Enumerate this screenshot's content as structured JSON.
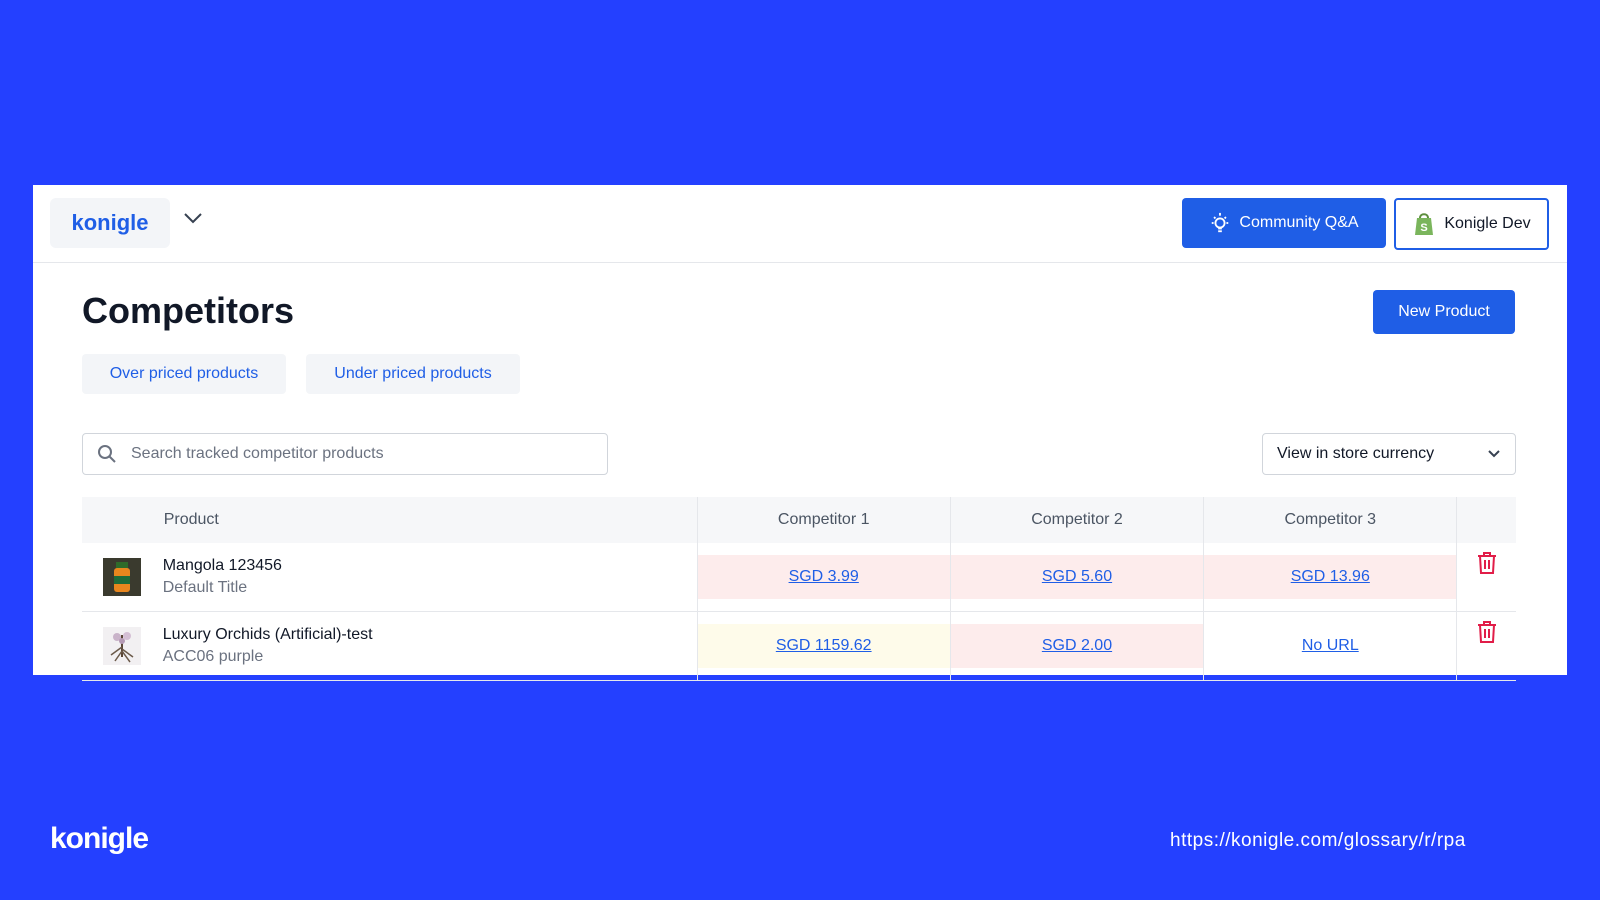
{
  "header": {
    "brand": "konigle",
    "community_label": "Community Q&A",
    "store_label": "Konigle Dev"
  },
  "page": {
    "title": "Competitors",
    "new_product_label": "New Product",
    "filters": [
      "Over priced products",
      "Under priced products"
    ]
  },
  "search": {
    "placeholder": "Search tracked competitor products",
    "value": ""
  },
  "currency": {
    "selected": "View in store currency"
  },
  "table": {
    "columns": [
      "Product",
      "Competitor 1",
      "Competitor 2",
      "Competitor 3"
    ],
    "rows": [
      {
        "name": "Mangola 123456",
        "variant": "Default Title",
        "prices": [
          {
            "text": "SGD 3.99",
            "status": "over"
          },
          {
            "text": "SGD 5.60",
            "status": "over"
          },
          {
            "text": "SGD 13.96",
            "status": "over"
          }
        ]
      },
      {
        "name": "Luxury Orchids (Artificial)-test",
        "variant": "ACC06 purple",
        "prices": [
          {
            "text": "SGD 1159.62",
            "status": "under"
          },
          {
            "text": "SGD 2.00",
            "status": "over"
          },
          {
            "text": "No URL",
            "status": "none"
          }
        ]
      }
    ]
  },
  "footer": {
    "logo": "konigle",
    "url": "https://konigle.com/glossary/r/rpa"
  },
  "colors": {
    "background": "#2440ff",
    "accent": "#1f5ee6",
    "over_priced_bg": "#fdecec",
    "under_priced_bg": "#fefbea",
    "delete": "#e11d48"
  }
}
